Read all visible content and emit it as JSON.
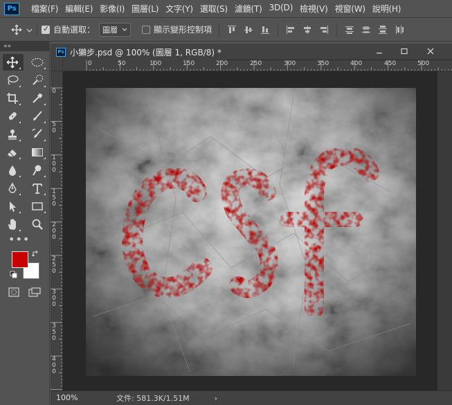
{
  "app": {
    "logo": "Ps"
  },
  "menu": [
    "檔案(F)",
    "編輯(E)",
    "影像(I)",
    "圖層(L)",
    "文字(Y)",
    "選取(S)",
    "濾鏡(T)",
    "3D(D)",
    "檢視(V)",
    "視窗(W)",
    "說明(H)"
  ],
  "options": {
    "auto_select_label": "自動選取：",
    "auto_select_value": "圖層",
    "show_transform_label": "顯示變形控制項"
  },
  "document": {
    "tab_title": "小獺步.psd @ 100% (圖層 1, RGB/8) *",
    "tab_icon": "Ps",
    "ruler_top_labels": [
      "0",
      "50",
      "100",
      "150",
      "200",
      "250",
      "300",
      "350",
      "400",
      "450",
      "500"
    ],
    "ruler_left_labels": [
      "0",
      "50",
      "100",
      "150",
      "200",
      "250",
      "300",
      "350",
      "400"
    ],
    "canvas_text": "CSF",
    "text_color": "#b50b0b"
  },
  "status": {
    "zoom": "100%",
    "doc_info": "文件: 581.3K/1.51M",
    "arrow": "›"
  },
  "colors": {
    "foreground": "#c90000",
    "background": "#ffffff",
    "ui_bg": "#535353",
    "pasteboard": "#282828"
  }
}
